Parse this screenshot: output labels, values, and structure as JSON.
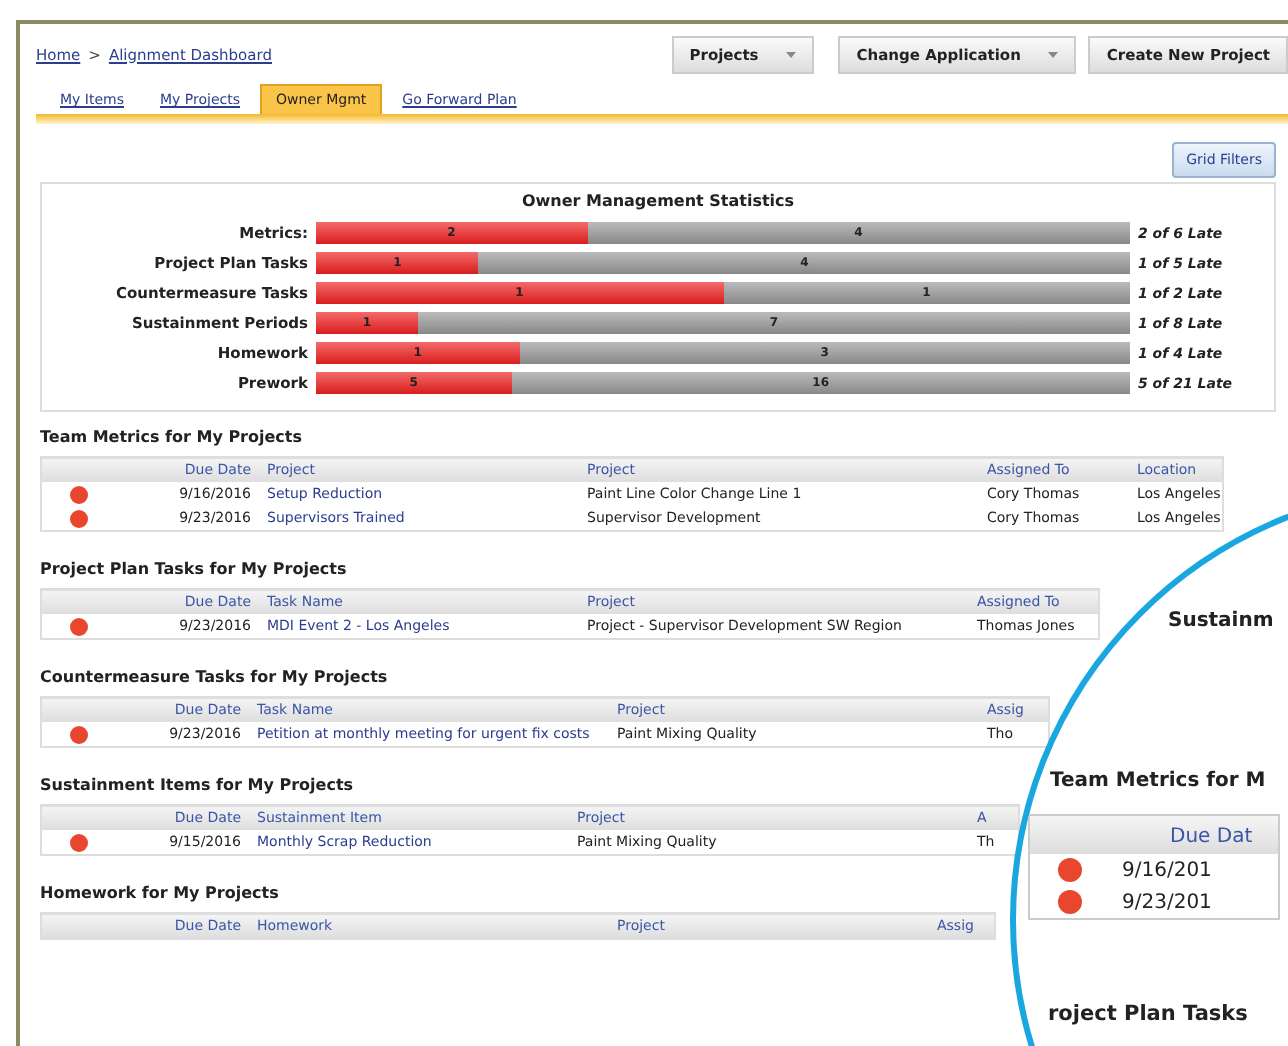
{
  "breadcrumb": [
    {
      "label": "Home"
    },
    {
      "label": "Alignment Dashboard"
    }
  ],
  "breadcrumb_separator": ">",
  "header_buttons": [
    {
      "label": "Projects",
      "has_menu": true
    },
    {
      "label": "Change Application",
      "has_menu": true
    },
    {
      "label": "Create New Project",
      "has_menu": false
    }
  ],
  "tabs": [
    {
      "label": "My Items",
      "selected": false
    },
    {
      "label": "My Projects",
      "selected": false
    },
    {
      "label": "Owner Mgmt",
      "selected": true
    },
    {
      "label": "Go Forward Plan",
      "selected": false
    }
  ],
  "grid_filters_button": "Grid Filters",
  "statistics": {
    "title": "Owner Management Statistics",
    "rows": [
      {
        "label": "Metrics:",
        "late": "2",
        "on_time": "4",
        "level": 0.333,
        "summary": "2 of 6 Late"
      },
      {
        "label": "Project Plan Tasks",
        "late": "1",
        "on_time": "4",
        "level": 0.2,
        "summary": "1 of 5 Late"
      },
      {
        "label": "Countermeasure Tasks",
        "late": "1",
        "on_time": "1",
        "level": 0.5,
        "summary": "1 of 2 Late"
      },
      {
        "label": "Sustainment Periods",
        "late": "1",
        "on_time": "7",
        "level": 0.125,
        "summary": "1 of 8 Late"
      },
      {
        "label": "Homework",
        "late": "1",
        "on_time": "3",
        "level": 0.25,
        "summary": "1 of 4 Late"
      },
      {
        "label": "Prework",
        "late": "5",
        "on_time": "16",
        "level": 0.24,
        "summary": "5 of 21 Late"
      }
    ]
  },
  "sections": [
    {
      "title": "Team Metrics for My Projects",
      "columns": [
        {
          "label": "Due Date",
          "kind": "date"
        },
        {
          "label": "Project",
          "kind": "link"
        },
        {
          "label": "Project",
          "kind": "text"
        },
        {
          "label": "Assigned To",
          "kind": "text"
        },
        {
          "label": "Location",
          "kind": "text"
        }
      ],
      "rows": [
        {
          "color": "#e8472e",
          "cells": [
            "9/16/2016",
            "Setup Reduction",
            "Paint Line Color Change Line 1",
            "Cory Thomas",
            "Los Angeles"
          ]
        },
        {
          "color": "#e8472e",
          "cells": [
            "9/23/2016",
            "Supervisors Trained",
            "Supervisor Development",
            "Cory Thomas",
            "Los Angeles"
          ]
        }
      ]
    },
    {
      "title": "Project Plan Tasks for My Projects",
      "columns": [
        {
          "label": "Due Date",
          "kind": "date"
        },
        {
          "label": "Task Name",
          "kind": "link"
        },
        {
          "label": "Project",
          "kind": "text"
        },
        {
          "label": "Assigned To",
          "kind": "text"
        }
      ],
      "rows": [
        {
          "color": "#e8472e",
          "cells": [
            "9/23/2016",
            "MDI Event 2 - Los Angeles",
            "Project - Supervisor Development SW Region",
            "Thomas Jones"
          ]
        }
      ]
    },
    {
      "title": "Countermeasure Tasks for My Projects",
      "columns": [
        {
          "label": "Due Date",
          "kind": "date"
        },
        {
          "label": "Task Name",
          "kind": "link"
        },
        {
          "label": "Project",
          "kind": "text"
        },
        {
          "label": "Assig",
          "kind": "text"
        }
      ],
      "rows": [
        {
          "color": "#e8472e",
          "cells": [
            "9/23/2016",
            "Petition at monthly meeting for urgent fix costs",
            "Paint Mixing Quality",
            "Tho"
          ]
        }
      ]
    },
    {
      "title": "Sustainment Items for My Projects",
      "columns": [
        {
          "label": "Due Date",
          "kind": "date"
        },
        {
          "label": "Sustainment Item",
          "kind": "link"
        },
        {
          "label": "Project",
          "kind": "text"
        },
        {
          "label": "A",
          "kind": "text"
        }
      ],
      "rows": [
        {
          "color": "#e8472e",
          "cells": [
            "9/15/2016",
            "Monthly Scrap Reduction",
            "Paint Mixing Quality",
            "Th"
          ]
        }
      ]
    },
    {
      "title": "Homework for My Projects",
      "columns": [
        {
          "label": "Due Date",
          "kind": "date"
        },
        {
          "label": "Homework",
          "kind": "link"
        },
        {
          "label": "Project",
          "kind": "text"
        },
        {
          "label": "Assig",
          "kind": "text"
        }
      ]
    }
  ],
  "magnifier": {
    "top_text": "Sustainm",
    "heading": "Team Metrics for M",
    "column": "Due Dat",
    "rows": [
      {
        "color": "#e8472e",
        "date": "9/16/201"
      },
      {
        "color": "#e8472e",
        "date": "9/23/201"
      }
    ],
    "next_heading": "roject Plan Tasks"
  }
}
